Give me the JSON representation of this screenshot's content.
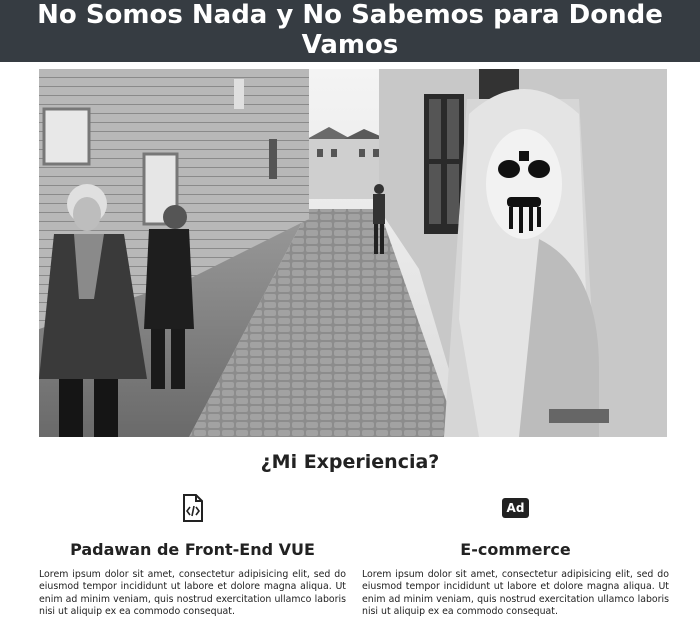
{
  "header": {
    "title": "No Somos Nada y No Sabemos para Donde Vamos"
  },
  "hero": {
    "image": "black-and-white photo of cobblestone alley with corpse-paint metal musician and pedestrians"
  },
  "experience": {
    "title": "¿Mi Experiencia?",
    "columns": [
      {
        "icon": "code-file-icon",
        "title": "Padawan de Front-End VUE",
        "text": "Lorem ipsum dolor sit amet, consectetur adipisicing elit, sed do eiusmod tempor incididunt ut labore et dolore magna aliqua. Ut enim ad minim veniam, quis nostrud exercitation ullamco laboris nisi ut aliquip ex ea commodo consequat."
      },
      {
        "icon": "ad-icon",
        "icon_text": "Ad",
        "title": "E-commerce",
        "text": "Lorem ipsum dolor sit amet, consectetur adipisicing elit, sed do eiusmod tempor incididunt ut labore et dolore magna aliqua. Ut enim ad minim veniam, quis nostrud exercitation ullamco laboris nisi ut aliquip ex ea commodo consequat."
      }
    ]
  }
}
